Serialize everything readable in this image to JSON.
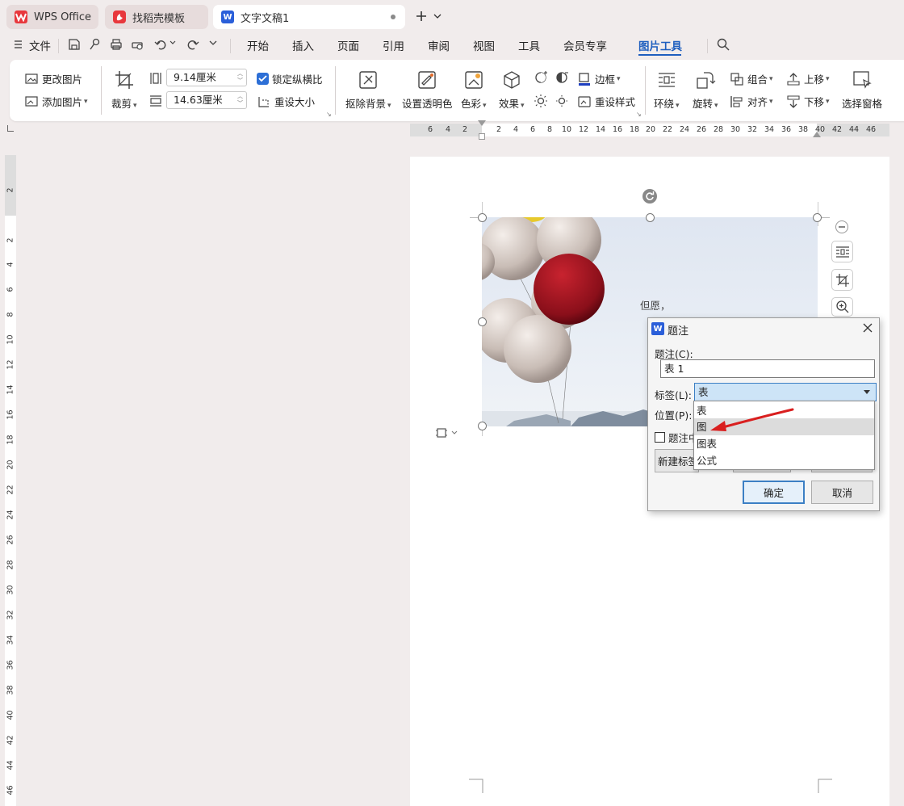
{
  "tabs": [
    {
      "label": "WPS Office",
      "icon": "wps-logo-icon"
    },
    {
      "label": "找稻壳模板",
      "icon": "docer-logo-icon"
    },
    {
      "label": "文字文稿1",
      "icon": "writer-logo-icon",
      "logo_letter": "W"
    }
  ],
  "menu": {
    "file": "文件",
    "items": [
      "开始",
      "插入",
      "页面",
      "引用",
      "审阅",
      "视图",
      "工具",
      "会员专享",
      "图片工具"
    ],
    "active": "图片工具",
    "accent": "#1f5fbf"
  },
  "ribbon": {
    "change_picture": "更改图片",
    "add_picture": "添加图片",
    "crop": "裁剪",
    "width": "9.14厘米",
    "height": "14.63厘米",
    "lock_ratio": "锁定纵横比",
    "lock_ratio_checked": true,
    "reset_size": "重设大小",
    "remove_bg": "抠除背景",
    "set_transparent": "设置透明色",
    "color": "色彩",
    "effects": "效果",
    "border": "边框",
    "reset_style": "重设样式",
    "wrap": "环绕",
    "rotate": "旋转",
    "group": "组合",
    "align": "对齐",
    "move_up": "上移",
    "move_down": "下移",
    "selection_pane": "选择窗格"
  },
  "ruler": {
    "h_left": [
      "6",
      "4",
      "2"
    ],
    "h_right": [
      "2",
      "4",
      "6",
      "8",
      "10",
      "12",
      "14",
      "16",
      "18",
      "20",
      "22",
      "24",
      "26",
      "28",
      "30",
      "32",
      "34",
      "36",
      "38",
      "40",
      "42",
      "44",
      "46"
    ],
    "v_top": "2",
    "v": [
      "2",
      "4",
      "6",
      "8",
      "10",
      "12",
      "14",
      "16",
      "18",
      "20",
      "22",
      "24",
      "26",
      "28",
      "30",
      "32",
      "34",
      "36",
      "38",
      "40",
      "42",
      "44",
      "46"
    ]
  },
  "document": {
    "image_text": "但愿，"
  },
  "dialog": {
    "title": "题注",
    "caption_label": "题注(C):",
    "caption_value": "表 1",
    "label_label": "标签(L):",
    "label_value": "表",
    "position_label": "位置(P):",
    "exclude_label": "题注中",
    "new_label_button": "新建标签",
    "ok_button": "确定",
    "cancel_button": "取消",
    "options": [
      "表",
      "图",
      "图表",
      "公式"
    ],
    "highlighted_option": "图"
  }
}
